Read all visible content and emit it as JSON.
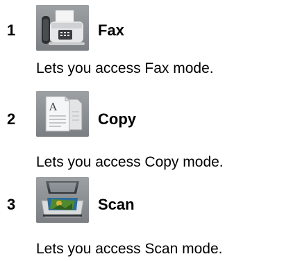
{
  "items": [
    {
      "number": "1",
      "label": "Fax",
      "icon": "fax-icon",
      "description": "Lets you access Fax mode."
    },
    {
      "number": "2",
      "label": "Copy",
      "icon": "copy-icon",
      "description": "Lets you access Copy mode."
    },
    {
      "number": "3",
      "label": "Scan",
      "icon": "scanner-icon",
      "description": "Lets you access Scan mode."
    }
  ]
}
